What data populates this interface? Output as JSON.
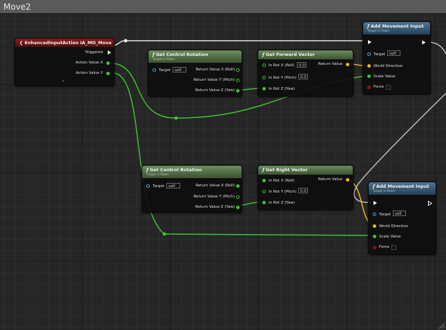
{
  "window": {
    "title": "Move2"
  },
  "colors": {
    "exec": "#ffffff",
    "float": "#3ec430",
    "vector": "#f0b820",
    "object": "#4aa8e8",
    "bool": "#7a1414"
  },
  "nodes": {
    "event": {
      "title": "EnhancedInputAction IA_MO_Move",
      "pins": [
        "Triggered",
        "Action Value X",
        "Action Value Y"
      ],
      "expand": "⌄"
    },
    "rot1": {
      "title": "Get Control Rotation",
      "subtitle": "Target is Pawn",
      "target": "Target",
      "target_value": "self",
      "outputs": [
        "Return Value X (Roll)",
        "Return Value Y (Pitch)",
        "Return Value Z (Yaw)"
      ]
    },
    "fwd": {
      "title": "Get Forward Vector",
      "inputs": [
        "In Rot X (Roll)",
        "In Rot Y (Pitch)",
        "In Rot Z (Yaw)"
      ],
      "values": [
        "0.0",
        "0.0"
      ],
      "output": "Return Value"
    },
    "move1": {
      "title": "Add Movement Input",
      "subtitle": "Target is Pawn",
      "target": "Target",
      "target_value": "self",
      "inputs": [
        "World Direction",
        "Scale Value",
        "Force"
      ]
    },
    "rot2": {
      "title": "Get Control Rotation",
      "subtitle": "Target is Pawn",
      "target": "Target",
      "target_value": "self",
      "outputs": [
        "Return Value X (Roll)",
        "Return Value Y (Pitch)",
        "Return Value Z (Yaw)"
      ]
    },
    "right": {
      "title": "Get Right Vector",
      "inputs": [
        "In Rot X (Roll)",
        "In Rot Y (Pitch)",
        "In Rot Z (Yaw)"
      ],
      "values": [
        "0.0",
        "0.0"
      ],
      "output": "Return Value"
    },
    "move2": {
      "title": "Add Movement Input",
      "subtitle": "Target is Pawn",
      "target": "Target",
      "target_value": "self",
      "inputs": [
        "World Direction",
        "Scale Value",
        "Force"
      ]
    }
  },
  "icons": {
    "function": "function-icon",
    "event": "event-arrow-icon"
  }
}
